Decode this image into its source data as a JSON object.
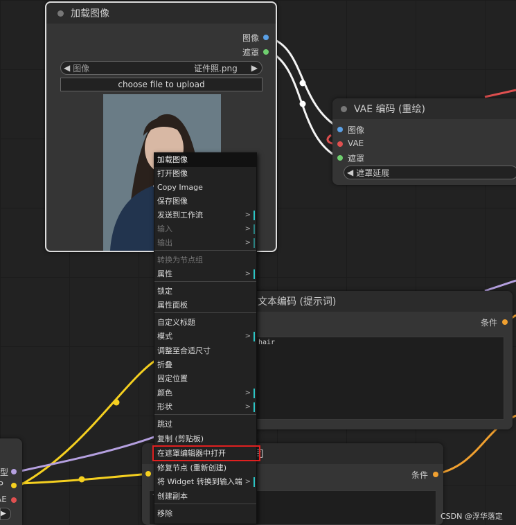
{
  "load_image_node": {
    "title": "加载图像",
    "outputs": [
      "图像",
      "遮罩"
    ],
    "image_widget": {
      "label": "图像",
      "value": "证件照.png"
    },
    "upload_label": "choose file to upload"
  },
  "vae_node": {
    "title": "VAE 编码 (重绘)",
    "inputs": [
      "图像",
      "VAE",
      "遮罩"
    ],
    "widget_label": "遮罩延展"
  },
  "text_node": {
    "title": "文本编码 (提示词)",
    "output": "条件",
    "text": "hair"
  },
  "text_node_2": {
    "title_fragment": "司",
    "output": "条件",
    "text": "t"
  },
  "left_node": {
    "labels": [
      "型",
      "IP",
      "AE"
    ]
  },
  "context_menu": {
    "items": [
      {
        "label": "加载图像",
        "kind": "title"
      },
      {
        "label": "打开图像"
      },
      {
        "label": "Copy Image"
      },
      {
        "label": "保存图像"
      },
      {
        "label": "发送到工作流",
        "submenu": true
      },
      {
        "label": "输入",
        "submenu": true,
        "disabled": true
      },
      {
        "label": "输出",
        "submenu": true,
        "disabled": true
      },
      {
        "label": "转换为节点组",
        "disabled": true
      },
      {
        "label": "属性",
        "submenu": true
      },
      {
        "label": "锁定"
      },
      {
        "label": "属性面板"
      },
      {
        "label": "自定义标题"
      },
      {
        "label": "模式",
        "submenu": true
      },
      {
        "label": "调整至合适尺寸"
      },
      {
        "label": "折叠"
      },
      {
        "label": "固定位置"
      },
      {
        "label": "颜色",
        "submenu": true
      },
      {
        "label": "形状",
        "submenu": true
      },
      {
        "label": "跳过"
      },
      {
        "label": "复制 (剪贴板)"
      },
      {
        "label": "在遮罩编辑器中打开",
        "highlighted": true
      },
      {
        "label": "修复节点 (重新创建)"
      },
      {
        "label": "将 Widget 转换到输入端",
        "submenu": true
      },
      {
        "label": "创建副本"
      },
      {
        "label": "移除"
      }
    ]
  },
  "watermark": "CSDN @浮华落定",
  "colors": {
    "image": "#5aa0e6",
    "mask": "#6fcf6f",
    "vae": "#e05050",
    "conditioning": "#f0a030",
    "clip": "#f5d020",
    "model": "#b5a0e0",
    "highlight": "#e02020"
  }
}
